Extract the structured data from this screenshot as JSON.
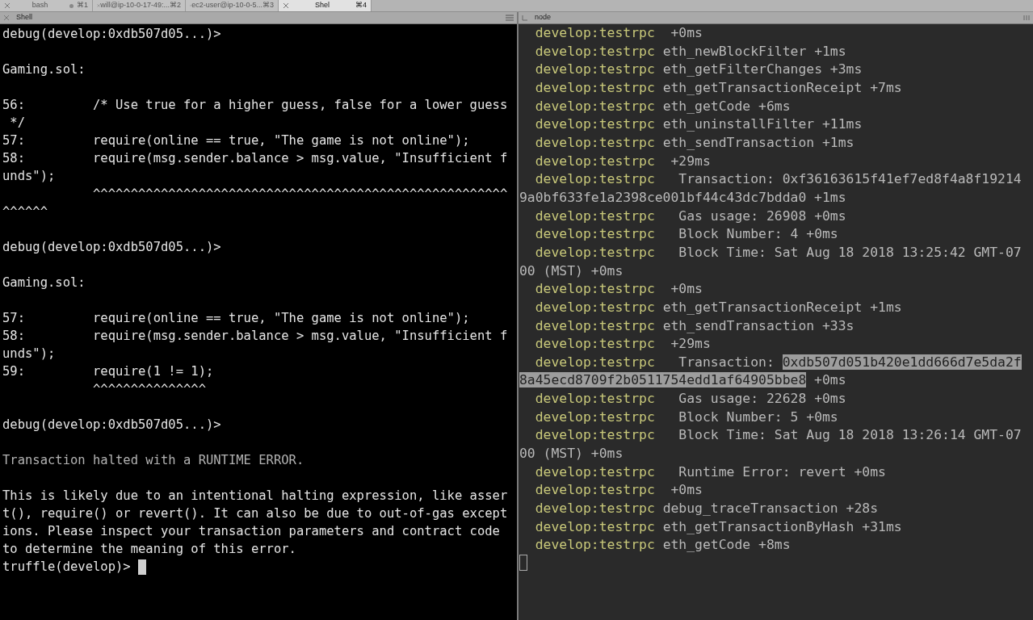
{
  "tab_bar": {
    "tabs": [
      {
        "label": "bash",
        "shortcut": "⌘1",
        "selected": false,
        "activity": true
      },
      {
        "label": "will@ip-10-0-17-49:...",
        "shortcut": "⌘2",
        "selected": false,
        "activity": false
      },
      {
        "label": "ec2-user@ip-10-0-5...",
        "shortcut": "⌘3",
        "selected": false,
        "activity": false
      },
      {
        "label": "Shel",
        "shortcut": "⌘4",
        "selected": true,
        "activity": false
      }
    ]
  },
  "panes": [
    {
      "title": "Shell",
      "kind": "shell",
      "blocks": [
        {
          "kind": "text",
          "lines": [
            "debug(develop:0xdb507d05...)>"
          ]
        },
        {
          "kind": "text",
          "lines": [
            "Gaming.sol:"
          ]
        },
        {
          "kind": "text",
          "lines": [
            "56:         /* Use true for a higher guess, false for a lower guess",
            " */",
            "57:         require(online == true, \"The game is not online\");",
            "58:         require(msg.sender.balance > msg.value, \"Insufficient f",
            "unds\");",
            "            ^^^^^^^^^^^^^^^^^^^^^^^^^^^^^^^^^^^^^^^^^^^^^^^^^^^^^^^",
            "^^^^^^"
          ]
        },
        {
          "kind": "text",
          "lines": [
            "debug(develop:0xdb507d05...)>"
          ]
        },
        {
          "kind": "text",
          "lines": [
            "Gaming.sol:"
          ]
        },
        {
          "kind": "text",
          "lines": [
            "57:         require(online == true, \"The game is not online\");",
            "58:         require(msg.sender.balance > msg.value, \"Insufficient f",
            "unds\");",
            "59:         require(1 != 1);",
            "            ^^^^^^^^^^^^^^^"
          ]
        },
        {
          "kind": "text",
          "lines": [
            "debug(develop:0xdb507d05...)>"
          ]
        },
        {
          "kind": "dim",
          "lines": [
            "Transaction halted with a RUNTIME ERROR."
          ]
        },
        {
          "kind": "text",
          "lines": [
            "This is likely due to an intentional halting expression, like asser",
            "t(), require() or revert(). It can also be due to out-of-gas except",
            "ions. Please inspect your transaction parameters and contract code",
            "to determine the meaning of this error."
          ]
        }
      ],
      "prompt": {
        "text": "truffle(develop)>",
        "cursor": {
          "filled": true
        }
      }
    },
    {
      "title": "node",
      "kind": "log",
      "lines": [
        {
          "parts": [
            {
              "kind": "tag",
              "text": "develop:testrpc"
            },
            {
              "kind": "text",
              "text": "  +0ms"
            }
          ]
        },
        {
          "parts": [
            {
              "kind": "tag",
              "text": "develop:testrpc"
            },
            {
              "kind": "text",
              "text": " eth_newBlockFilter +1ms"
            }
          ]
        },
        {
          "parts": [
            {
              "kind": "tag",
              "text": "develop:testrpc"
            },
            {
              "kind": "text",
              "text": " eth_getFilterChanges +3ms"
            }
          ]
        },
        {
          "parts": [
            {
              "kind": "tag",
              "text": "develop:testrpc"
            },
            {
              "kind": "text",
              "text": " eth_getTransactionReceipt +7ms"
            }
          ]
        },
        {
          "parts": [
            {
              "kind": "tag",
              "text": "develop:testrpc"
            },
            {
              "kind": "text",
              "text": " eth_getCode +6ms"
            }
          ]
        },
        {
          "parts": [
            {
              "kind": "tag",
              "text": "develop:testrpc"
            },
            {
              "kind": "text",
              "text": " eth_uninstallFilter +11ms"
            }
          ]
        },
        {
          "parts": [
            {
              "kind": "tag",
              "text": "develop:testrpc"
            },
            {
              "kind": "text",
              "text": " eth_sendTransaction +1ms"
            }
          ]
        },
        {
          "parts": [
            {
              "kind": "tag",
              "text": "develop:testrpc"
            },
            {
              "kind": "text",
              "text": "  +29ms"
            }
          ]
        },
        {
          "parts": [
            {
              "kind": "tag",
              "text": "develop:testrpc"
            },
            {
              "kind": "text",
              "text": "   Transaction: 0xf36163615f41ef7ed8f4a8f19214"
            }
          ]
        },
        {
          "parts": [
            {
              "kind": "text",
              "text": "9a0bf633fe1a2398ce001bf44c43dc7bdda0 +1ms"
            }
          ]
        },
        {
          "parts": [
            {
              "kind": "tag",
              "text": "develop:testrpc"
            },
            {
              "kind": "text",
              "text": "   Gas usage: 26908 +0ms"
            }
          ]
        },
        {
          "parts": [
            {
              "kind": "tag",
              "text": "develop:testrpc"
            },
            {
              "kind": "text",
              "text": "   Block Number: 4 +0ms"
            }
          ]
        },
        {
          "parts": [
            {
              "kind": "tag",
              "text": "develop:testrpc"
            },
            {
              "kind": "text",
              "text": "   Block Time: Sat Aug 18 2018 13:25:42 GMT-07"
            }
          ]
        },
        {
          "parts": [
            {
              "kind": "text",
              "text": "00 (MST) +0ms"
            }
          ]
        },
        {
          "parts": [
            {
              "kind": "tag",
              "text": "develop:testrpc"
            },
            {
              "kind": "text",
              "text": "  +0ms"
            }
          ]
        },
        {
          "parts": [
            {
              "kind": "tag",
              "text": "develop:testrpc"
            },
            {
              "kind": "text",
              "text": " eth_getTransactionReceipt +1ms"
            }
          ]
        },
        {
          "parts": [
            {
              "kind": "tag",
              "text": "develop:testrpc"
            },
            {
              "kind": "text",
              "text": " eth_sendTransaction +33s"
            }
          ]
        },
        {
          "parts": [
            {
              "kind": "tag",
              "text": "develop:testrpc"
            },
            {
              "kind": "text",
              "text": "  +29ms"
            }
          ]
        },
        {
          "parts": [
            {
              "kind": "tag",
              "text": "develop:testrpc"
            },
            {
              "kind": "text",
              "text": "   Transaction: "
            },
            {
              "kind": "selection",
              "text": "0xdb507d051b420e1dd666d7e5da2f"
            }
          ]
        },
        {
          "parts": [
            {
              "kind": "selection",
              "text": "8a45ecd8709f2b0511754edd1af64905bbe8"
            },
            {
              "kind": "text",
              "text": " +0ms"
            }
          ]
        },
        {
          "parts": [
            {
              "kind": "tag",
              "text": "develop:testrpc"
            },
            {
              "kind": "text",
              "text": "   Gas usage: 22628 +0ms"
            }
          ]
        },
        {
          "parts": [
            {
              "kind": "tag",
              "text": "develop:testrpc"
            },
            {
              "kind": "text",
              "text": "   Block Number: 5 +0ms"
            }
          ]
        },
        {
          "parts": [
            {
              "kind": "tag",
              "text": "develop:testrpc"
            },
            {
              "kind": "text",
              "text": "   Block Time: Sat Aug 18 2018 13:26:14 GMT-07"
            }
          ]
        },
        {
          "parts": [
            {
              "kind": "text",
              "text": "00 (MST) +0ms"
            }
          ]
        },
        {
          "parts": [
            {
              "kind": "tag",
              "text": "develop:testrpc"
            },
            {
              "kind": "text",
              "text": "   Runtime Error: revert +0ms"
            }
          ]
        },
        {
          "parts": [
            {
              "kind": "tag",
              "text": "develop:testrpc"
            },
            {
              "kind": "text",
              "text": "  +0ms"
            }
          ]
        },
        {
          "parts": [
            {
              "kind": "tag",
              "text": "develop:testrpc"
            },
            {
              "kind": "text",
              "text": " debug_traceTransaction +28s"
            }
          ]
        },
        {
          "parts": [
            {
              "kind": "tag",
              "text": "develop:testrpc"
            },
            {
              "kind": "text",
              "text": " eth_getTransactionByHash +31ms"
            }
          ]
        },
        {
          "parts": [
            {
              "kind": "tag",
              "text": "develop:testrpc"
            },
            {
              "kind": "text",
              "text": " eth_getCode +8ms"
            }
          ]
        }
      ],
      "cursor": {
        "filled": false
      }
    }
  ]
}
